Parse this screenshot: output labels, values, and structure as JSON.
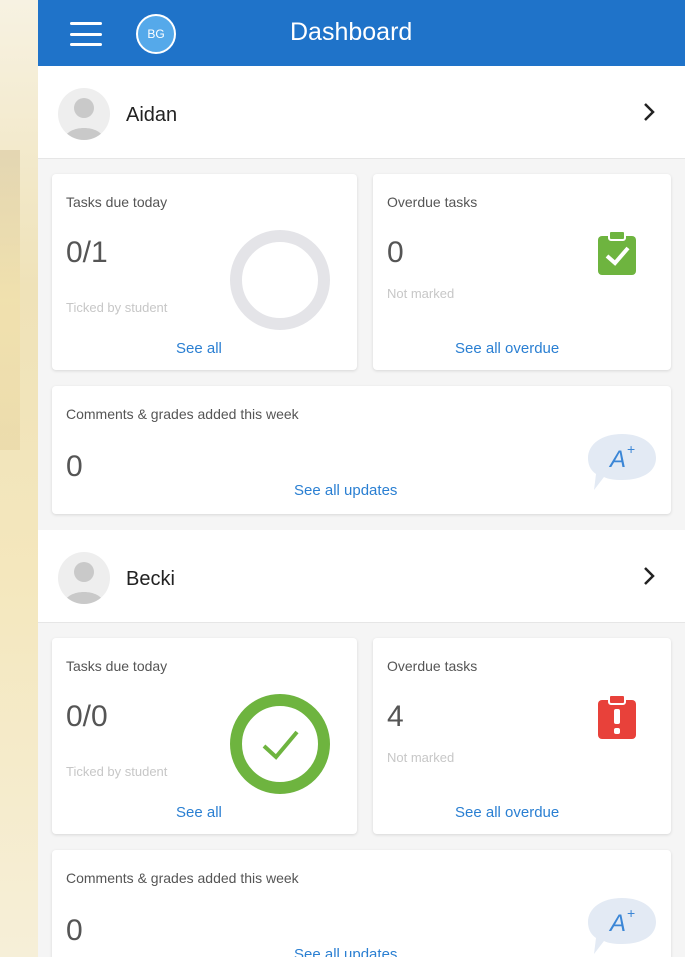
{
  "header": {
    "badge": "BG",
    "title": "Dashboard"
  },
  "labels": {
    "tasks_due": "Tasks due today",
    "overdue": "Overdue tasks",
    "ticked": "Ticked by student",
    "not_marked": "Not marked",
    "see_all": "See all",
    "see_all_overdue": "See all overdue",
    "comments": "Comments & grades added this week",
    "see_all_updates": "See all updates",
    "grade_icon_text": "A+"
  },
  "students": [
    {
      "name": "Aidan",
      "tasks_due_value": "0/1",
      "overdue_value": "0",
      "comments_value": "0",
      "tasks_complete": false,
      "overdue_status": "ok"
    },
    {
      "name": "Becki",
      "tasks_due_value": "0/0",
      "overdue_value": "4",
      "comments_value": "0",
      "tasks_complete": true,
      "overdue_status": "alert"
    }
  ],
  "colors": {
    "topbar": "#1f73c9",
    "link": "#2a7fd2",
    "success": "#6eb43f",
    "alert": "#e8413a",
    "ring_empty": "#e4e4e8"
  }
}
